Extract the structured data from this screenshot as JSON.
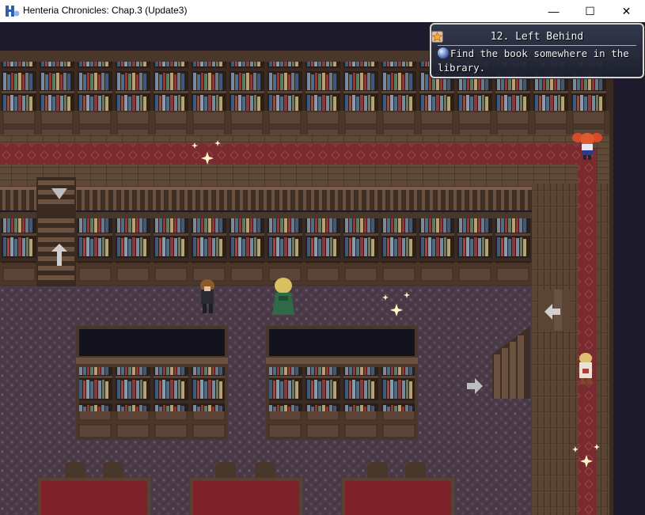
{
  "window": {
    "title": "Henteria Chronicles: Chap.3 (Update3)",
    "minimize_glyph": "—",
    "maximize_glyph": "☐",
    "close_glyph": "✕"
  },
  "quest": {
    "title": "12. Left Behind",
    "description": "Find the book somewhere in the library.",
    "title_icon": "star-icon",
    "description_icon": "orb-icon"
  },
  "colors": {
    "carpet": "#4a3a47",
    "wood": "#5b4535",
    "runner_red": "#7a2b30",
    "table_red": "#7e2129",
    "void": "#1c1a2b"
  }
}
